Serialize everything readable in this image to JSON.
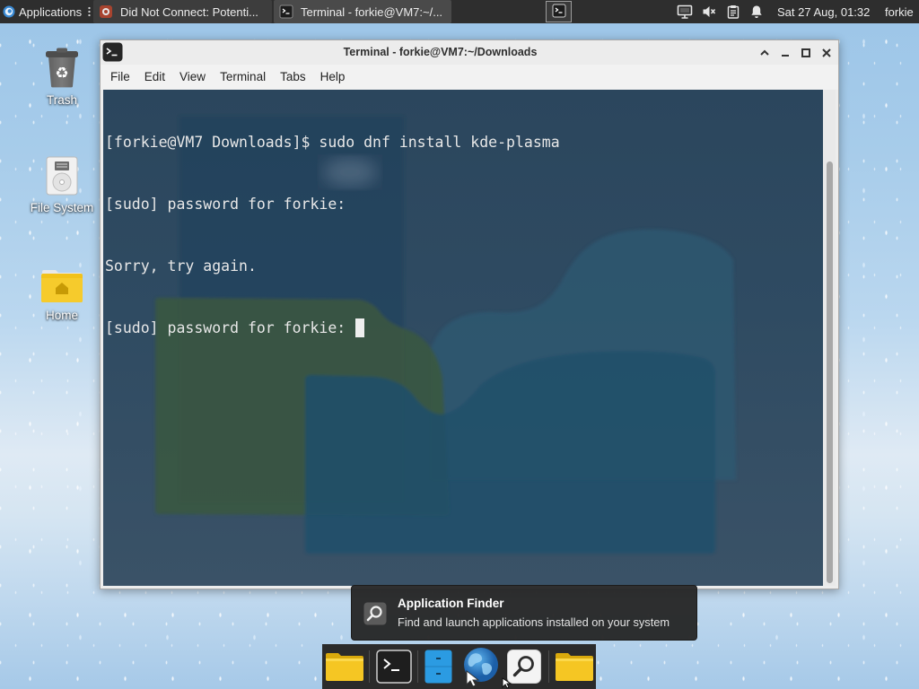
{
  "top_panel": {
    "applications_label": "Applications",
    "applications_icon": "xfce-applications-icon",
    "tasks": [
      {
        "label": "Did Not Connect: Potenti...",
        "icon": "browser-tab-icon",
        "active": false
      },
      {
        "label": "Terminal - forkie@VM7:~/...",
        "icon": "terminal-icon",
        "active": true
      }
    ],
    "workspace_icon": "terminal-icon",
    "tray_icons": [
      "display-icon",
      "volume-muted-icon",
      "clipboard-icon",
      "notification-bell-icon"
    ],
    "clock": "Sat 27 Aug, 01:32",
    "user": "forkie"
  },
  "desktop_icons": [
    {
      "label": "Trash",
      "icon": "trash-icon"
    },
    {
      "label": "File System",
      "icon": "drive-icon"
    },
    {
      "label": "Home",
      "icon": "home-folder-icon"
    }
  ],
  "terminal": {
    "title": "Terminal - forkie@VM7:~/Downloads",
    "window_buttons": [
      "shade-icon",
      "minimize-icon",
      "maximize-icon",
      "close-icon"
    ],
    "menu": [
      "File",
      "Edit",
      "View",
      "Terminal",
      "Tabs",
      "Help"
    ],
    "lines": [
      "[forkie@VM7 Downloads]$ sudo dnf install kde-plasma",
      "[sudo] password for forkie:",
      "Sorry, try again.",
      "[sudo] password for forkie: "
    ]
  },
  "tooltip": {
    "icon": "search-icon",
    "title": "Application Finder",
    "description": "Find and launch applications installed on your system"
  },
  "dock": {
    "items": [
      "folder-icon",
      "terminal-icon",
      "file-manager-icon",
      "web-browser-icon",
      "app-finder-icon",
      "folder-icon"
    ]
  },
  "colors": {
    "panel_bg": "#2e2e2e",
    "terminal_bg": "#2f4b62",
    "terminal_text": "#e8e8e8",
    "tooltip_bg": "#262626",
    "desktop_sky": "#a7ccea"
  }
}
